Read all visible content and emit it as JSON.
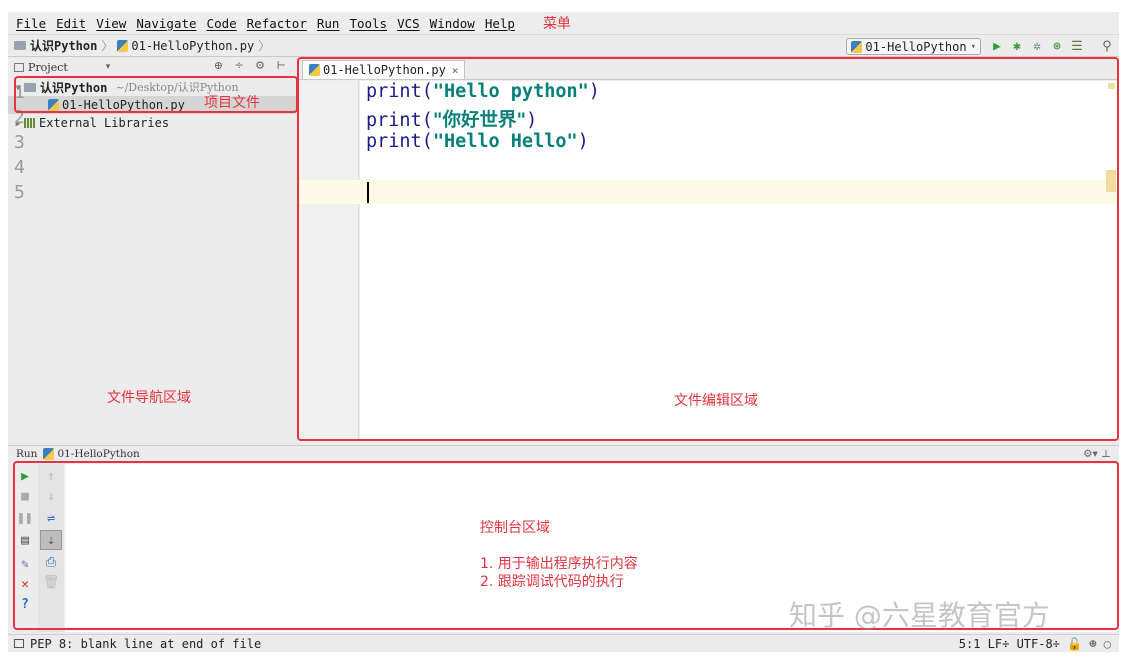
{
  "menu": {
    "items": [
      "File",
      "Edit",
      "View",
      "Navigate",
      "Code",
      "Refactor",
      "Run",
      "Tools",
      "VCS",
      "Window",
      "Help"
    ],
    "annotation": "菜单"
  },
  "navbar": {
    "project": "认识Python",
    "file": "01-HelloPython.py",
    "run_config": "01-HelloPython"
  },
  "project_panel": {
    "title": "Project",
    "root_name": "认识Python",
    "root_path": "~/Desktop/认识Python",
    "file": "01-HelloPython.py",
    "libraries": "External Libraries",
    "annotation": "项目文件",
    "region_label": "文件导航区域"
  },
  "editor": {
    "tab": "01-HelloPython.py",
    "line_numbers": [
      "1",
      "2",
      "3",
      "4",
      "5"
    ],
    "lines": [
      {
        "pre": "print(",
        "str": "\"Hello python\"",
        "post": ")"
      },
      {
        "pre": "print(",
        "str": "\"你好世界\"",
        "post": ")"
      },
      {
        "pre": "print(",
        "str": "\"Hello Hello\"",
        "post": ")"
      }
    ],
    "region_label": "文件编辑区域"
  },
  "run_panel": {
    "title": "Run",
    "config": "01-HelloPython",
    "region_label": "控制台区域",
    "notes": [
      "1. 用于输出程序执行内容",
      "2. 跟踪调试代码的执行"
    ]
  },
  "statusbar": {
    "message": "PEP 8: blank line at end of file",
    "right": "5:1  LF÷  UTF-8÷"
  },
  "watermark": "知乎 @六星教育官方",
  "colors": {
    "annotation": "#e5333f",
    "string": "#07807a",
    "keyword": "#1c1c8a"
  }
}
